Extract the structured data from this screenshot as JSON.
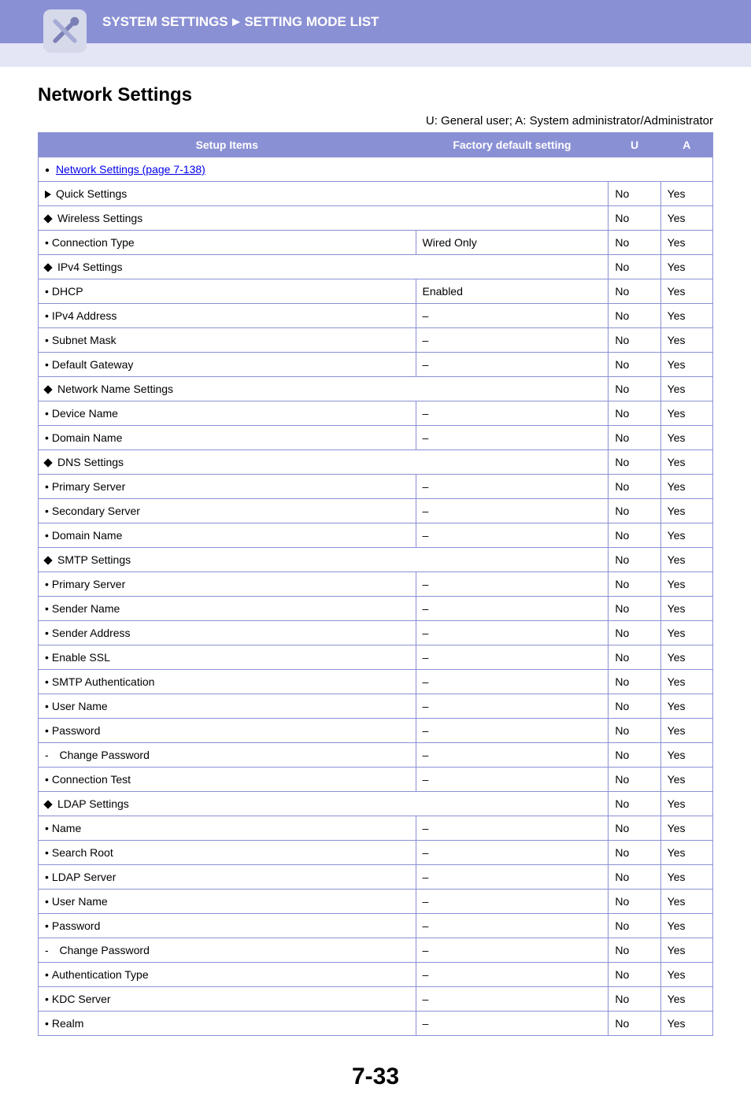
{
  "header": {
    "breadcrumb1": "SYSTEM SETTINGS",
    "breadcrumb2": "SETTING MODE LIST"
  },
  "page_title": "Network Settings",
  "legend": "U: General user; A: System administrator/Administrator",
  "columns": {
    "items": "Setup Items",
    "default": "Factory default setting",
    "u": "U",
    "a": "A"
  },
  "link_row": {
    "text": "Network Settings (page 7-138)"
  },
  "rows": [
    {
      "style": "triangle",
      "indent": 1,
      "label": "Quick Settings",
      "default": null,
      "span": true,
      "u": "No",
      "a": "Yes"
    },
    {
      "style": "diamond",
      "indent": 2,
      "label": "Wireless Settings",
      "default": null,
      "span": true,
      "u": "No",
      "a": "Yes"
    },
    {
      "style": "dot",
      "indent": 3,
      "label": "Connection Type",
      "default": "Wired Only",
      "span": false,
      "u": "No",
      "a": "Yes"
    },
    {
      "style": "diamond",
      "indent": 2,
      "label": "IPv4 Settings",
      "default": null,
      "span": true,
      "u": "No",
      "a": "Yes"
    },
    {
      "style": "dot",
      "indent": 3,
      "label": "DHCP",
      "default": "Enabled",
      "span": false,
      "u": "No",
      "a": "Yes"
    },
    {
      "style": "dot",
      "indent": 3,
      "label": "IPv4 Address",
      "default": "–",
      "span": false,
      "u": "No",
      "a": "Yes"
    },
    {
      "style": "dot",
      "indent": 3,
      "label": "Subnet Mask",
      "default": "–",
      "span": false,
      "u": "No",
      "a": "Yes"
    },
    {
      "style": "dot",
      "indent": 3,
      "label": "Default Gateway",
      "default": "–",
      "span": false,
      "u": "No",
      "a": "Yes"
    },
    {
      "style": "diamond",
      "indent": 2,
      "label": "Network Name Settings",
      "default": null,
      "span": true,
      "u": "No",
      "a": "Yes"
    },
    {
      "style": "dot",
      "indent": 3,
      "label": "Device Name",
      "default": "–",
      "span": false,
      "u": "No",
      "a": "Yes"
    },
    {
      "style": "dot",
      "indent": 3,
      "label": "Domain Name",
      "default": "–",
      "span": false,
      "u": "No",
      "a": "Yes"
    },
    {
      "style": "diamond",
      "indent": 2,
      "label": "DNS Settings",
      "default": null,
      "span": true,
      "u": "No",
      "a": "Yes"
    },
    {
      "style": "dot",
      "indent": 3,
      "label": "Primary Server",
      "default": "–",
      "span": false,
      "u": "No",
      "a": "Yes"
    },
    {
      "style": "dot",
      "indent": 3,
      "label": "Secondary Server",
      "default": "–",
      "span": false,
      "u": "No",
      "a": "Yes"
    },
    {
      "style": "dot",
      "indent": 3,
      "label": "Domain Name",
      "default": "–",
      "span": false,
      "u": "No",
      "a": "Yes"
    },
    {
      "style": "diamond",
      "indent": 2,
      "label": "SMTP Settings",
      "default": null,
      "span": true,
      "u": "No",
      "a": "Yes"
    },
    {
      "style": "dot",
      "indent": 3,
      "label": "Primary Server",
      "default": "–",
      "span": false,
      "u": "No",
      "a": "Yes"
    },
    {
      "style": "dot",
      "indent": 3,
      "label": "Sender Name",
      "default": "–",
      "span": false,
      "u": "No",
      "a": "Yes"
    },
    {
      "style": "dot",
      "indent": 3,
      "label": "Sender Address",
      "default": "–",
      "span": false,
      "u": "No",
      "a": "Yes"
    },
    {
      "style": "dot",
      "indent": 3,
      "label": "Enable SSL",
      "default": "–",
      "span": false,
      "u": "No",
      "a": "Yes"
    },
    {
      "style": "dot",
      "indent": 3,
      "label": "SMTP Authentication",
      "default": "–",
      "span": false,
      "u": "No",
      "a": "Yes"
    },
    {
      "style": "dot",
      "indent": 3,
      "label": "User Name",
      "default": "–",
      "span": false,
      "u": "No",
      "a": "Yes"
    },
    {
      "style": "dot",
      "indent": 3,
      "label": "Password",
      "default": "–",
      "span": false,
      "u": "No",
      "a": "Yes"
    },
    {
      "style": "dash",
      "indent": 4,
      "label": "Change Password",
      "default": "–",
      "span": false,
      "u": "No",
      "a": "Yes"
    },
    {
      "style": "dot",
      "indent": 3,
      "label": "Connection Test",
      "default": "–",
      "span": false,
      "u": "No",
      "a": "Yes"
    },
    {
      "style": "diamond",
      "indent": 2,
      "label": "LDAP Settings",
      "default": null,
      "span": true,
      "u": "No",
      "a": "Yes"
    },
    {
      "style": "dot",
      "indent": 3,
      "label": "Name",
      "default": "–",
      "span": false,
      "u": "No",
      "a": "Yes"
    },
    {
      "style": "dot",
      "indent": 3,
      "label": "Search Root",
      "default": "–",
      "span": false,
      "u": "No",
      "a": "Yes"
    },
    {
      "style": "dot",
      "indent": 3,
      "label": "LDAP Server",
      "default": "–",
      "span": false,
      "u": "No",
      "a": "Yes"
    },
    {
      "style": "dot",
      "indent": 3,
      "label": "User Name",
      "default": "–",
      "span": false,
      "u": "No",
      "a": "Yes"
    },
    {
      "style": "dot",
      "indent": 3,
      "label": "Password",
      "default": "–",
      "span": false,
      "u": "No",
      "a": "Yes"
    },
    {
      "style": "dash",
      "indent": 4,
      "label": "Change Password",
      "default": "–",
      "span": false,
      "u": "No",
      "a": "Yes"
    },
    {
      "style": "dot",
      "indent": 3,
      "label": "Authentication Type",
      "default": "–",
      "span": false,
      "u": "No",
      "a": "Yes"
    },
    {
      "style": "dot",
      "indent": 3,
      "label": "KDC Server",
      "default": "–",
      "span": false,
      "u": "No",
      "a": "Yes"
    },
    {
      "style": "dot",
      "indent": 3,
      "label": "Realm",
      "default": "–",
      "span": false,
      "u": "No",
      "a": "Yes"
    }
  ],
  "page_number": "7-33"
}
